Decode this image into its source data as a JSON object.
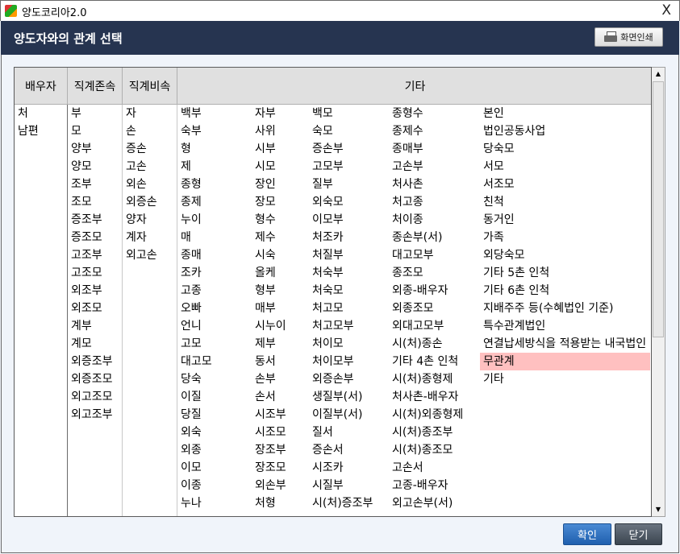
{
  "window": {
    "title": "양도코리아2.0",
    "close": "X"
  },
  "header": {
    "title": "양도자와의 관계 선택",
    "print_label": "화면인쇄"
  },
  "table": {
    "headers": [
      "배우자",
      "직계존속",
      "직계비속",
      "기타"
    ],
    "spouse": [
      "처",
      "남편"
    ],
    "ascendants": [
      "부",
      "모",
      "양부",
      "양모",
      "조부",
      "조모",
      "증조부",
      "증조모",
      "고조부",
      "고조모",
      "외조부",
      "외조모",
      "계부",
      "계모",
      "외증조부",
      "외증조모",
      "외고조모",
      "외고조부"
    ],
    "descendants": [
      "자",
      "손",
      "증손",
      "고손",
      "외손",
      "외증손",
      "양자",
      "계자",
      "외고손"
    ],
    "other": [
      [
        "백부",
        "숙부",
        "형",
        "제",
        "종형",
        "종제",
        "누이",
        "매",
        "종매",
        "조카",
        "고종",
        "오빠",
        "언니",
        "고모",
        "대고모",
        "당숙",
        "이질",
        "당질",
        "외숙",
        "외종",
        "이모",
        "이종",
        "누나"
      ],
      [
        "자부",
        "사위",
        "시부",
        "시모",
        "장인",
        "장모",
        "형수",
        "제수",
        "시숙",
        "올케",
        "형부",
        "매부",
        "시누이",
        "제부",
        "동서",
        "손부",
        "손서",
        "시조부",
        "시조모",
        "장조부",
        "장조모",
        "외손부",
        "처형"
      ],
      [
        "백모",
        "숙모",
        "증손부",
        "고모부",
        "질부",
        "외숙모",
        "이모부",
        "처조카",
        "처질부",
        "처숙부",
        "처숙모",
        "처고모",
        "처고모부",
        "처이모",
        "처이모부",
        "외증손부",
        "생질부(서)",
        "이질부(서)",
        "질서",
        "증손서",
        "시조카",
        "시질부",
        "시(처)증조부"
      ],
      [
        "종형수",
        "종제수",
        "종매부",
        "고손부",
        "처사촌",
        "처고종",
        "처이종",
        "종손부(서)",
        "대고모부",
        "종조모",
        "외종-배우자",
        "외종조모",
        "외대고모부",
        "시(처)종손",
        "기타 4촌 인척",
        "시(처)종형제",
        "처사촌-배우자",
        "시(처)외종형제",
        "시(처)종조부",
        "시(처)종조모",
        "고손서",
        "고종-배우자",
        "외고손부(서)"
      ],
      [
        "본인",
        "법인공동사업",
        "당숙모",
        "서모",
        "서조모",
        "친척",
        "동거인",
        "가족",
        "외당숙모",
        "기타 5촌 인척",
        "기타 6촌 인척",
        "지배주주 등(수혜법인 기준)",
        "특수관계법인",
        "연결납세방식을 적용받는 내국법인",
        "무관계",
        "기타"
      ]
    ],
    "selected": "무관계",
    "highlight_color": "#ffc0c0"
  },
  "buttons": {
    "ok": "확인",
    "close": "닫기"
  }
}
